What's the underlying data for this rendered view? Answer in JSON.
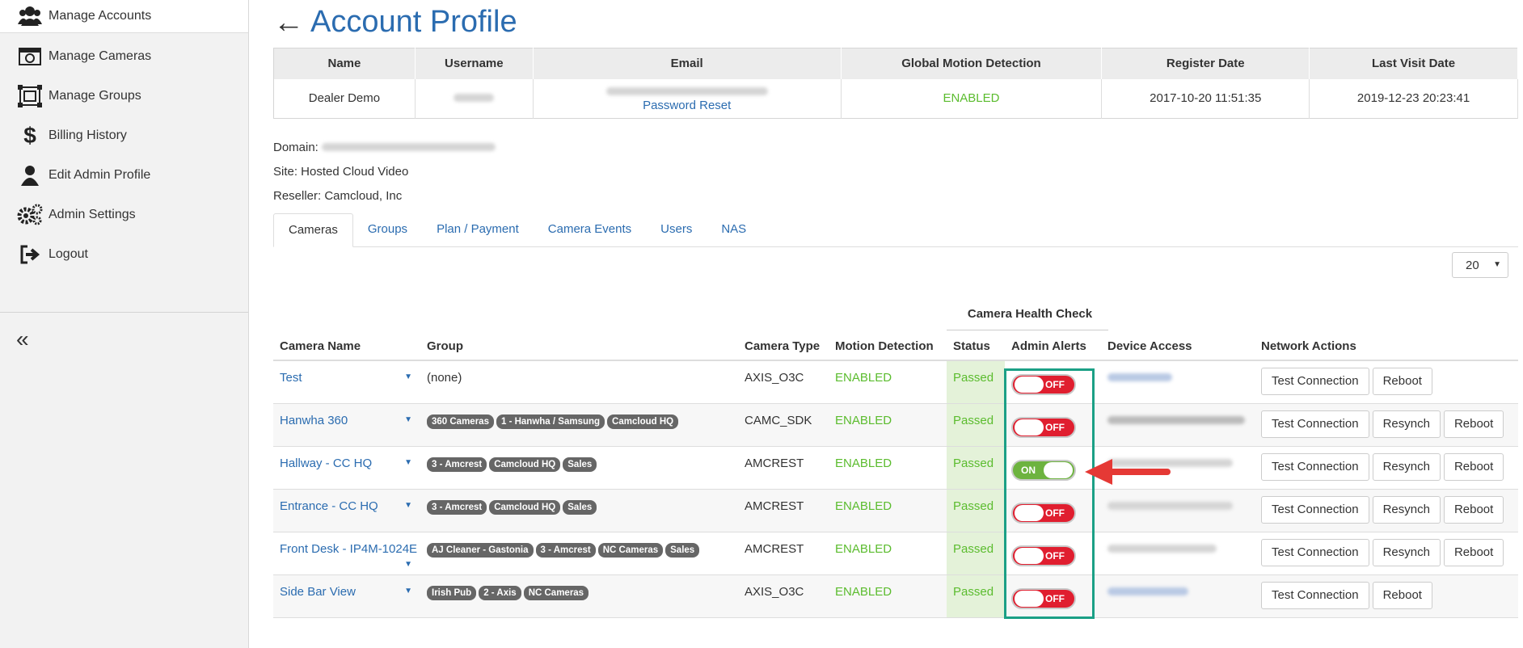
{
  "sidebar": {
    "items": [
      {
        "label": "Manage Accounts",
        "icon": "users-icon"
      },
      {
        "label": "Manage Cameras",
        "icon": "camera-icon"
      },
      {
        "label": "Manage Groups",
        "icon": "groups-icon"
      },
      {
        "label": "Billing History",
        "icon": "dollar-icon"
      },
      {
        "label": "Edit Admin Profile",
        "icon": "user-icon"
      },
      {
        "label": "Admin Settings",
        "icon": "gears-icon"
      },
      {
        "label": "Logout",
        "icon": "logout-icon"
      }
    ],
    "collapse_label": "«"
  },
  "header": {
    "back": "←",
    "title": "Account Profile"
  },
  "profile": {
    "columns": [
      "Name",
      "Username",
      "Email",
      "Global Motion Detection",
      "Register Date",
      "Last Visit Date"
    ],
    "name": "Dealer Demo",
    "password_reset": "Password Reset",
    "global_motion": "ENABLED",
    "register_date": "2017-10-20 11:51:35",
    "last_visit": "2019-12-23 20:23:41"
  },
  "info": {
    "domain_label": "Domain:",
    "site": "Site: Hosted Cloud Video",
    "reseller": "Reseller: Camcloud, Inc"
  },
  "tabs": [
    "Cameras",
    "Groups",
    "Plan / Payment",
    "Camera Events",
    "Users",
    "NAS"
  ],
  "page_size": "20",
  "health_check_title": "Camera Health Check",
  "columns": [
    "Camera Name",
    "Group",
    "Camera Type",
    "Motion Detection",
    "Status",
    "Admin Alerts",
    "Device Access",
    "Network Actions"
  ],
  "cameras": [
    {
      "name": "Test",
      "groups": [],
      "none": "(none)",
      "type": "AXIS_O3C",
      "motion": "ENABLED",
      "status": "Passed",
      "alert": "OFF",
      "actions": [
        "Test Connection",
        "Reboot"
      ]
    },
    {
      "name": "Hanwha 360",
      "groups": [
        "360 Cameras",
        "1 - Hanwha / Samsung",
        "Camcloud HQ"
      ],
      "type": "CAMC_SDK",
      "motion": "ENABLED",
      "status": "Passed",
      "alert": "OFF",
      "actions": [
        "Test Connection",
        "Resynch",
        "Reboot"
      ]
    },
    {
      "name": "Hallway - CC HQ",
      "groups": [
        "3 - Amcrest",
        "Camcloud HQ",
        "Sales"
      ],
      "type": "AMCREST",
      "motion": "ENABLED",
      "status": "Passed",
      "alert": "ON",
      "actions": [
        "Test Connection",
        "Resynch",
        "Reboot"
      ]
    },
    {
      "name": "Entrance - CC HQ",
      "groups": [
        "3 - Amcrest",
        "Camcloud HQ",
        "Sales"
      ],
      "type": "AMCREST",
      "motion": "ENABLED",
      "status": "Passed",
      "alert": "OFF",
      "actions": [
        "Test Connection",
        "Resynch",
        "Reboot"
      ]
    },
    {
      "name": "Front Desk - IP4M-1024E",
      "groups": [
        "AJ Cleaner - Gastonia",
        "3 - Amcrest",
        "NC Cameras",
        "Sales"
      ],
      "type": "AMCREST",
      "motion": "ENABLED",
      "status": "Passed",
      "alert": "OFF",
      "actions": [
        "Test Connection",
        "Resynch",
        "Reboot"
      ]
    },
    {
      "name": "Side Bar View",
      "groups": [
        "Irish Pub",
        "2 - Axis",
        "NC Cameras"
      ],
      "type": "AXIS_O3C",
      "motion": "ENABLED",
      "status": "Passed",
      "alert": "OFF",
      "actions": [
        "Test Connection",
        "Reboot"
      ]
    }
  ],
  "colors": {
    "link": "#2b6cb0",
    "enabled": "#5bbc2e",
    "off": "#e01e2f",
    "on": "#6db33f",
    "highlight": "#1ba086",
    "arrow": "#e53935"
  }
}
